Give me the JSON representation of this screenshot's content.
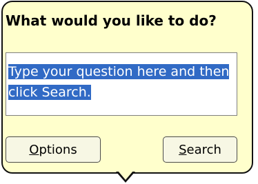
{
  "dialog": {
    "title": "What would you like to do?",
    "question_input": {
      "value": "Type your question here and then click Search."
    },
    "buttons": {
      "options": {
        "accel": "O",
        "rest": "ptions"
      },
      "search": {
        "accel": "S",
        "rest": "earch"
      }
    }
  },
  "colors": {
    "balloon_background": "#ffffcc",
    "selection_highlight": "#316ac5",
    "border": "#111111"
  }
}
